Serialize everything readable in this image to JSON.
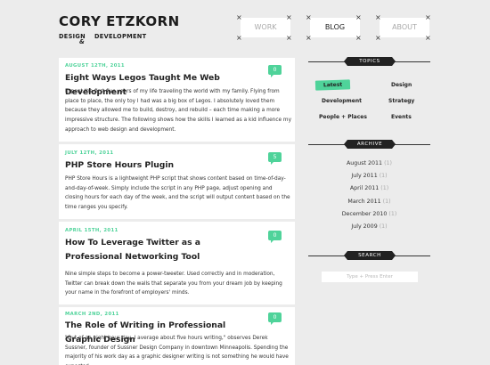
{
  "logo": {
    "name": "CORY ETZKORN",
    "sub_left": "DESIGN",
    "ampersand": "&",
    "sub_right": "DEVELOPMENT"
  },
  "nav": [
    {
      "label": "WORK",
      "active": false
    },
    {
      "label": "BLOG",
      "active": true
    },
    {
      "label": "ABOUT",
      "active": false
    }
  ],
  "nav_mark": "×",
  "posts": [
    {
      "date": "AUGUST 12TH, 2011",
      "title": "Eight Ways Legos Taught Me Web Development",
      "comments": "0",
      "body": "I spent the first five years of my life traveling the world with my family. Flying from place to place, the only toy I had was a big box of Legos. I absolutely loved them because they allowed me to build, destroy, and rebuild – each time making a more impressive structure. The following shows how the skills I learned as a kid influence my approach to web design and development."
    },
    {
      "date": "JULY 12TH, 2011",
      "title": "PHP Store Hours Plugin",
      "comments": "5",
      "body": "PHP Store Hours is a lightweight PHP script that shows content based on time-of-day-and-day-of-week. Simply include the script in any PHP page, adjust opening and closing hours for each day of the week, and the script will output content based on the time ranges you specify."
    },
    {
      "date": "APRIL 15TH, 2011",
      "title": "How To Leverage Twitter as a Professional Networking Tool",
      "comments": "0",
      "body": "Nine simple steps to become a power-tweeter. Used correctly and in moderation, Twitter can break down the walls that separate you from your dream job by keeping your name in the forefront of employers' minds."
    },
    {
      "date": "MARCH 2ND, 2011",
      "title": "The Role of Writing in Professional Graphic Design",
      "comments": "0",
      "body": "\"Out of an eight hour day, I average about five hours writing,\" observes Derek Sussner, founder of Sussner Design Company in downtown Minneapolis. Spending the majority of his work day as a graphic designer writing is not something he would have expected"
    }
  ],
  "sidebar": {
    "topics_heading": "TOPICS",
    "topics": [
      {
        "label": "Latest",
        "active": true
      },
      {
        "label": "Design",
        "active": false
      },
      {
        "label": "Development",
        "active": false
      },
      {
        "label": "Strategy",
        "active": false
      },
      {
        "label": "People + Places",
        "active": false
      },
      {
        "label": "Events",
        "active": false
      }
    ],
    "archive_heading": "ARCHIVE",
    "archive": [
      {
        "month": "August 2011",
        "count": "(1)"
      },
      {
        "month": "July 2011",
        "count": "(1)"
      },
      {
        "month": "April 2011",
        "count": "(1)"
      },
      {
        "month": "March 2011",
        "count": "(1)"
      },
      {
        "month": "December 2010",
        "count": "(1)"
      },
      {
        "month": "July 2009",
        "count": "(1)"
      }
    ],
    "search_heading": "SEARCH",
    "search_placeholder": "Type + Press Enter"
  },
  "colors": {
    "accent": "#4fd39a",
    "background": "#ececec",
    "heading_dark": "#222222"
  }
}
